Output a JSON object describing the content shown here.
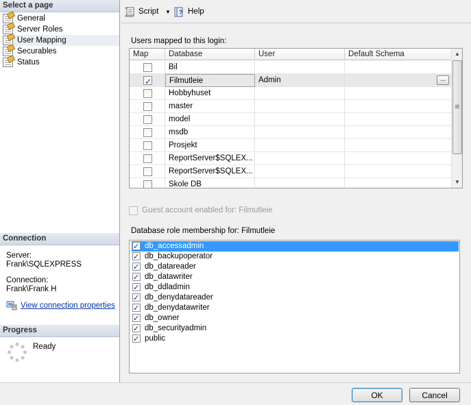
{
  "sidebar": {
    "select_page_title": "Select a page",
    "pages": [
      {
        "label": "General",
        "icon": "page-icon"
      },
      {
        "label": "Server Roles",
        "icon": "page-icon"
      },
      {
        "label": "User Mapping",
        "icon": "page-icon",
        "selected": true
      },
      {
        "label": "Securables",
        "icon": "page-icon"
      },
      {
        "label": "Status",
        "icon": "page-icon"
      }
    ],
    "connection": {
      "title": "Connection",
      "server_label": "Server:",
      "server_value": "Frank\\SQLEXPRESS",
      "connection_label": "Connection:",
      "connection_value": "Frank\\Frank H",
      "view_properties_link": "View connection properties"
    },
    "progress": {
      "title": "Progress",
      "status": "Ready"
    }
  },
  "toolbar": {
    "script_label": "Script",
    "help_label": "Help"
  },
  "users_mapped": {
    "label": "Users mapped to this login:",
    "columns": [
      "Map",
      "Database",
      "User",
      "Default Schema"
    ],
    "rows": [
      {
        "map": false,
        "database": "Bil",
        "user": "",
        "schema": ""
      },
      {
        "map": true,
        "database": "Filmutleie",
        "user": "Admin",
        "schema": "",
        "selected": true
      },
      {
        "map": false,
        "database": "Hobbyhuset",
        "user": "",
        "schema": ""
      },
      {
        "map": false,
        "database": "master",
        "user": "",
        "schema": ""
      },
      {
        "map": false,
        "database": "model",
        "user": "",
        "schema": ""
      },
      {
        "map": false,
        "database": "msdb",
        "user": "",
        "schema": ""
      },
      {
        "map": false,
        "database": "Prosjekt",
        "user": "",
        "schema": ""
      },
      {
        "map": false,
        "database": "ReportServer$SQLEX...",
        "user": "",
        "schema": ""
      },
      {
        "map": false,
        "database": "ReportServer$SQLEX...",
        "user": "",
        "schema": ""
      },
      {
        "map": false,
        "database": "Skole DB",
        "user": "",
        "schema": ""
      }
    ],
    "ellipsis_label": "..."
  },
  "guest_account": {
    "label": "Guest account enabled for: Filmutleie",
    "checked": false,
    "enabled": false
  },
  "roles": {
    "label": "Database role membership for: Filmutleie",
    "items": [
      {
        "name": "db_accessadmin",
        "checked": true,
        "selected": true
      },
      {
        "name": "db_backupoperator",
        "checked": true
      },
      {
        "name": "db_datareader",
        "checked": true
      },
      {
        "name": "db_datawriter",
        "checked": true
      },
      {
        "name": "db_ddladmin",
        "checked": true
      },
      {
        "name": "db_denydatareader",
        "checked": true
      },
      {
        "name": "db_denydatawriter",
        "checked": true
      },
      {
        "name": "db_owner",
        "checked": true
      },
      {
        "name": "db_securityadmin",
        "checked": true
      },
      {
        "name": "public",
        "checked": true
      }
    ]
  },
  "buttons": {
    "ok": "OK",
    "cancel": "Cancel"
  },
  "colors": {
    "selection": "#3399ff",
    "link": "#0033aa",
    "section_header": "#d2dae5"
  }
}
